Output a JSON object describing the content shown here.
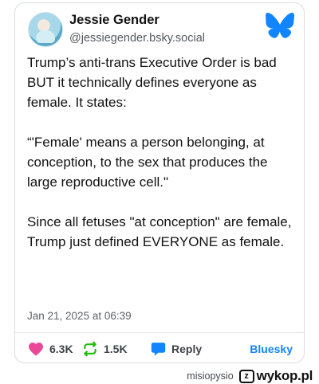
{
  "post": {
    "author_name": "Jessie Gender",
    "author_handle": "@jessiegender.bsky.social",
    "paragraphs": [
      "Trump’s anti-trans Executive Order is bad BUT it technically defines everyone as female. It states:",
      "“'Female' means a person belonging, at conception, to the sex that produces the large reproductive cell.\"",
      "Since all fetuses \"at conception\" are female, Trump just defined EVERYONE as female."
    ],
    "timestamp": "Jan 21, 2025 at 06:39"
  },
  "actions": {
    "likes": "6.3K",
    "reposts": "1.5K",
    "reply_label": "Reply",
    "bluesky_label": "Bluesky"
  },
  "footer": {
    "username": "misiopysio",
    "logo_letter": "z",
    "site_name": "wykop.pl"
  },
  "colors": {
    "like_pink": "#ec4899",
    "repost_green": "#20bc07",
    "reply_blue": "#1185fe",
    "bluesky_blue": "#1185fe"
  },
  "icons": [
    "avatar",
    "butterfly-icon",
    "heart-icon",
    "repost-icon",
    "reply-icon",
    "wykop-logo-icon"
  ]
}
